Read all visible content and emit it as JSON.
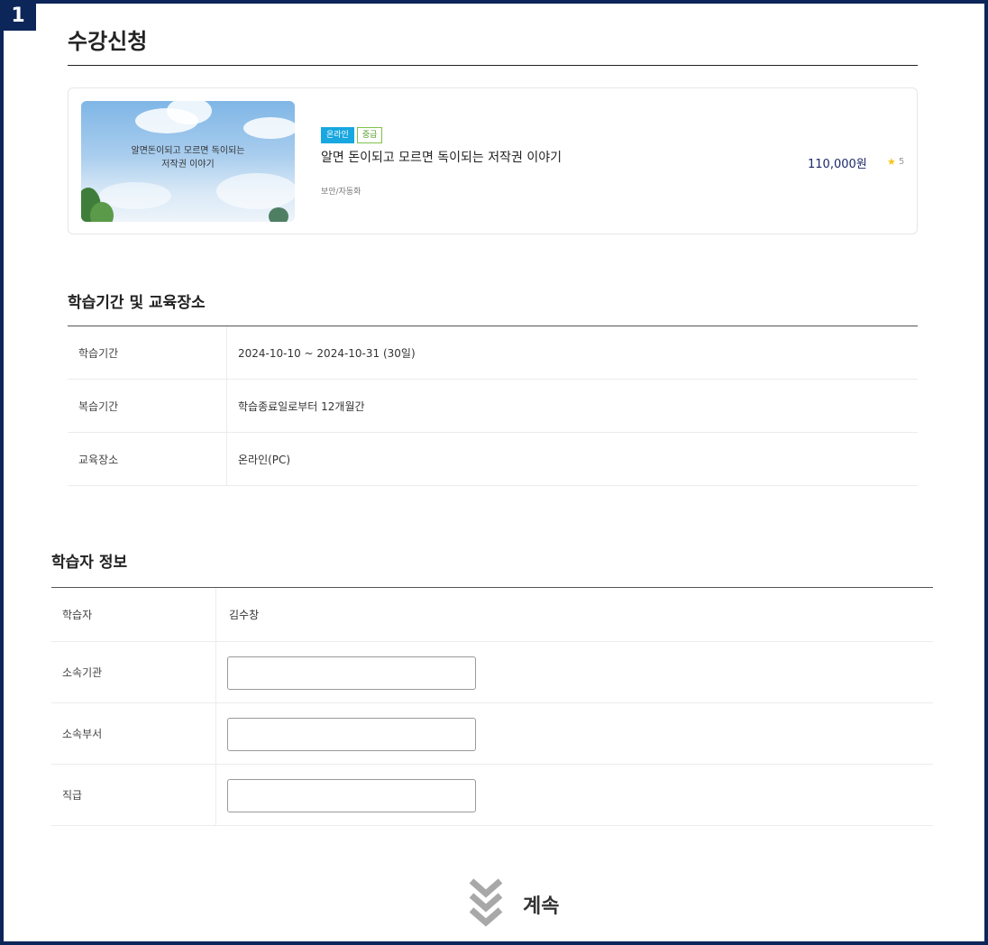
{
  "step_number": "1",
  "page_title": "수강신청",
  "course": {
    "thumb_text_line1": "알면돈이되고 모르면 독이되는",
    "thumb_text_line2": "저작권 이야기",
    "badge_online": "온라인",
    "badge_level": "중급",
    "name": "알면 돈이되고 모르면 독이되는 저작권 이야기",
    "category": "보안/자동화",
    "price": "110,000원",
    "rating": "5"
  },
  "schedule": {
    "title": "학습기간 및 교육장소",
    "rows": [
      {
        "label": "학습기간",
        "value": "2024-10-10 ~ 2024-10-31 (30일)"
      },
      {
        "label": "복습기간",
        "value": "학습종료일로부터 12개월간"
      },
      {
        "label": "교육장소",
        "value": "온라인(PC)"
      }
    ]
  },
  "learner": {
    "title": "학습자 정보",
    "name_label": "학습자",
    "name_value": "김수창",
    "org_label": "소속기관",
    "org_value": "",
    "dept_label": "소속부서",
    "dept_value": "",
    "rank_label": "직급",
    "rank_value": ""
  },
  "continue_label": "계속",
  "colors": {
    "frame": "#0d2659",
    "online_badge": "#18a7e0",
    "level_badge": "#7fc14a",
    "price": "#1c2a6b",
    "star": "#f5c518"
  }
}
